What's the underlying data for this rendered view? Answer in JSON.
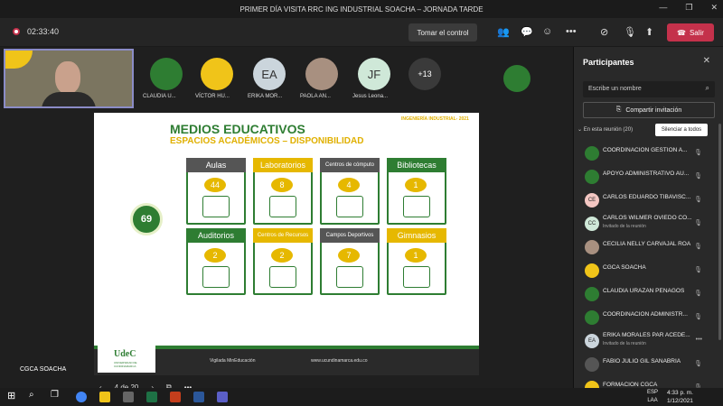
{
  "window": {
    "title": "PRIMER DÍA VISITA RRC ING INDUSTRIAL SOACHA – JORNADA TARDE"
  },
  "toolbar": {
    "timer": "02:33:40",
    "take_control": "Tomar el control",
    "leave": "Salir"
  },
  "gallery": {
    "self_label": "CGCA SOACHA",
    "participants": [
      {
        "name": "CLAUDIA U...",
        "color": "#2e7d32"
      },
      {
        "name": "VÍCTOR HU...",
        "color": "#f0c419"
      },
      {
        "name": "ERIKA MOR...",
        "initials": "EA",
        "color": "#cbd5dc"
      },
      {
        "name": "PAOLA AN...",
        "color": "#a89080"
      },
      {
        "name": "Jesus Leona...",
        "initials": "JF",
        "color": "#cfe8d8"
      }
    ],
    "extra": "+13"
  },
  "slide": {
    "title": "MEDIOS EDUCATIVOS",
    "subtitle": "ESPACIOS ACADÉMICOS – DISPONIBILIDAD",
    "tag": "INGENIERÍA INDUSTRIAL- 2021",
    "total": "69",
    "cards": [
      {
        "label": "Aulas",
        "value": "44",
        "head": "#555555"
      },
      {
        "label": "Laboratorios",
        "value": "8",
        "head": "#e6b800"
      },
      {
        "label": "Centros de cómputo",
        "value": "4",
        "head": "#555555"
      },
      {
        "label": "Bibliotecas",
        "value": "1",
        "head": "#2e7d32"
      },
      {
        "label": "Auditorios",
        "value": "2",
        "head": "#2e7d32"
      },
      {
        "label": "Centros de Recursos",
        "value": "2",
        "head": "#e6b800"
      },
      {
        "label": "Campos Deportivos",
        "value": "7",
        "head": "#555555"
      },
      {
        "label": "Gimnasios",
        "value": "1",
        "head": "#e6b800"
      }
    ],
    "footer_left": "Vigilada MinEducación",
    "footer_right": "www.ucundinamarca.edu.co",
    "logo_name": "UdeC",
    "logo_sub": "UNIVERSIDAD DE CUNDINAMARCA"
  },
  "pager": {
    "label": "4 de 20"
  },
  "panel": {
    "title": "Participantes",
    "search_placeholder": "Escribe un nombre",
    "share": "Compartir invitación",
    "in_meeting": "En esta reunión (20)",
    "mute_all": "Silenciar a todos",
    "people": [
      {
        "name": "COORDINACIÓN GESTIÓN A...",
        "color": "#2e7d32"
      },
      {
        "name": "APOYO ADMINISTRATIVO AU...",
        "color": "#2e7d32"
      },
      {
        "name": "CARLOS EDUARDO TIBAVISC...",
        "initials": "CE",
        "color": "#f4c7c3"
      },
      {
        "name": "CARLOS WILMER OVIEDO CO...",
        "initials": "CC",
        "color": "#cfe8d8",
        "sub": "Invitado de la reunión"
      },
      {
        "name": "CECILIA NELLY CARVAJAL ROA",
        "color": "#a89080"
      },
      {
        "name": "CGCA SOACHA",
        "color": "#f0c419"
      },
      {
        "name": "CLAUDIA URAZAN PENAGOS",
        "color": "#2e7d32"
      },
      {
        "name": "COORDINACIÓN ADMINISTR...",
        "color": "#2e7d32"
      },
      {
        "name": "ERIKA MORALES PAR ACEDE...",
        "initials": "EA",
        "color": "#cbd5dc",
        "sub": "Invitado de la reunión"
      },
      {
        "name": "FABIO JULIO GIL SANABRIA",
        "color": "#555555"
      },
      {
        "name": "FORMACIÓN CGCA",
        "color": "#f0c419"
      }
    ]
  },
  "taskbar": {
    "lang1": "ESP",
    "lang2": "LAA",
    "time": "4:33 p. m.",
    "date": "1/12/2021"
  }
}
